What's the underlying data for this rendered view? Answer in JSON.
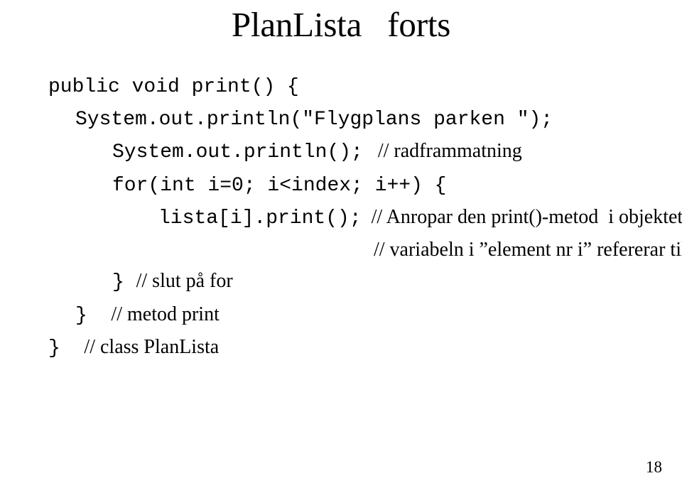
{
  "title": "PlanLista   forts",
  "lines": {
    "l1": "public void print() {",
    "l2": "System.out.println(\"Flygplans parken \");",
    "l3_code": "System.out.println();",
    "l3_comment": "   // radframmatning",
    "l4": "for(int i=0; i<index; i++) {",
    "l5_code": "lista[i].print();",
    "l5_comment": "  // Anropar den print()-metod  i objektet som",
    "l5b_comment": "// variabeln i ”element nr i” refererar till.",
    "l6_code": "} ",
    "l6_comment": "// slut på for",
    "l7_code": "}  ",
    "l7_comment": "// metod print",
    "l8_code": "}  ",
    "l8_comment": "// class PlanLista"
  },
  "page_number": "18"
}
